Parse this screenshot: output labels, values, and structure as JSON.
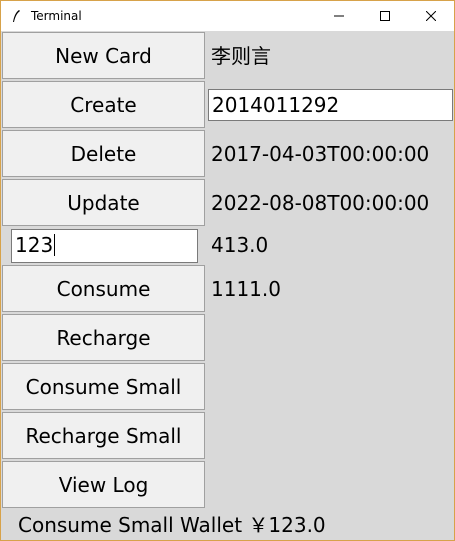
{
  "window": {
    "title": "Terminal",
    "controls": {
      "minimize": "minimize-icon",
      "maximize": "maximize-icon",
      "close": "close-icon"
    }
  },
  "buttons": {
    "new_card": "New Card",
    "create": "Create",
    "delete": "Delete",
    "update": "Update",
    "consume": "Consume",
    "recharge": "Recharge",
    "consume_small": "Consume Small",
    "recharge_small": "Recharge Small",
    "view_log": "View Log"
  },
  "inputs": {
    "amount": "123",
    "card_id": "2014011292"
  },
  "info": {
    "owner_name": "李则言",
    "created_at": "2017-04-03T00:00:00",
    "expires_at": "2022-08-08T00:00:00",
    "balance": "413.0",
    "secondary_balance": "1111.0"
  },
  "status": "Consume Small Wallet ￥123.0"
}
